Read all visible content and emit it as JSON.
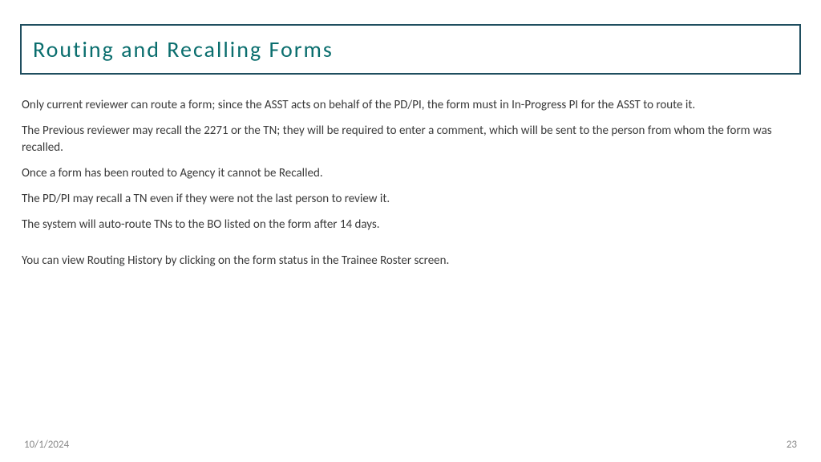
{
  "slide": {
    "title": "Routing and Recalling Forms",
    "paragraphs": [
      "Only current reviewer can route a form; since the ASST acts on behalf of the PD/PI, the form must in In-Progress PI for the ASST to route it.",
      "The Previous reviewer may recall the 2271 or the TN; they will be required to enter a comment, which will be sent to the person from whom the form was recalled.",
      "Once a form has been routed to Agency it cannot be Recalled.",
      "The PD/PI may recall a TN even if they were not the last person to review it.",
      "The system will auto-route TNs to the BO listed on the form after 14 days.",
      "You can view Routing History by clicking on the form status in the Trainee Roster screen."
    ],
    "footer": {
      "date": "10/1/2024",
      "page": "23"
    }
  }
}
